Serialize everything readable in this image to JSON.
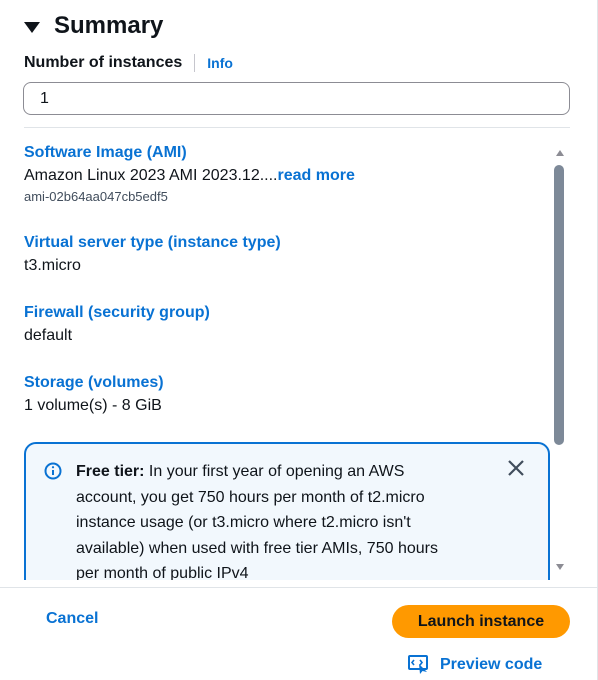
{
  "summary": {
    "title": "Summary",
    "instances_label": "Number of instances",
    "info_link": "Info",
    "instances_value": "1"
  },
  "items": {
    "ami": {
      "title": "Software Image (AMI)",
      "value": "Amazon Linux 2023 AMI 2023.12....",
      "read_more": "read more",
      "id": "ami-02b64aa047cb5edf5"
    },
    "instance_type": {
      "title": "Virtual server type (instance type)",
      "value": "t3.micro"
    },
    "firewall": {
      "title": "Firewall (security group)",
      "value": "default"
    },
    "storage": {
      "title": "Storage (volumes)",
      "value": "1 volume(s) - 8 GiB"
    }
  },
  "free_tier": {
    "label": "Free tier:",
    "text": " In your first year of opening an AWS account, you get 750 hours per month of t2.micro instance usage (or t3.micro where t2.micro isn't available) when used with free tier AMIs, 750 hours per month of public IPv4"
  },
  "footer": {
    "cancel_label": "Cancel",
    "launch_label": "Launch instance",
    "preview_label": "Preview code"
  },
  "colors": {
    "link": "#0972d3",
    "launch_button": "#ff9900",
    "info_box_bg": "#f2f8fd"
  }
}
